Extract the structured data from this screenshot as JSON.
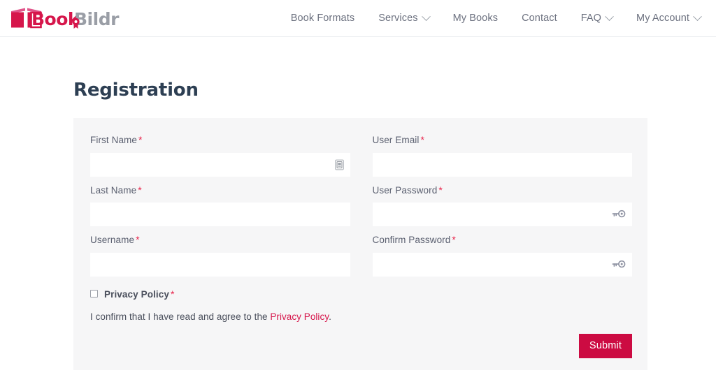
{
  "brand": {
    "name_part1": "Book",
    "name_part2": "Bildr",
    "color_primary": "#d6164b",
    "color_secondary": "#9a9ea6",
    "book_icon": "open-book-icon",
    "badge_icon": "ribbon-seal-icon"
  },
  "nav": {
    "items": [
      {
        "label": "Book Formats",
        "has_dropdown": false
      },
      {
        "label": "Services",
        "has_dropdown": true
      },
      {
        "label": "My Books",
        "has_dropdown": false
      },
      {
        "label": "Contact",
        "has_dropdown": false
      },
      {
        "label": "FAQ",
        "has_dropdown": true
      },
      {
        "label": "My Account",
        "has_dropdown": true
      }
    ]
  },
  "page": {
    "title": "Registration",
    "title_color": "#2d3f53"
  },
  "form": {
    "required_marker": "*",
    "fields_left": [
      {
        "label": "First Name",
        "required": true,
        "value": "",
        "placeholder": "",
        "type": "text",
        "icon": "autofill-icon",
        "name": "first-name"
      },
      {
        "label": "Last Name",
        "required": true,
        "value": "",
        "placeholder": "",
        "type": "text",
        "icon": "",
        "name": "last-name"
      },
      {
        "label": "Username",
        "required": true,
        "value": "",
        "placeholder": "",
        "type": "text",
        "icon": "",
        "name": "username"
      }
    ],
    "fields_right": [
      {
        "label": "User Email",
        "required": true,
        "value": "",
        "placeholder": "",
        "type": "text",
        "icon": "",
        "name": "user-email"
      },
      {
        "label": "User Password",
        "required": true,
        "value": "",
        "placeholder": "",
        "type": "password",
        "icon": "key-reveal-icon",
        "name": "user-password"
      },
      {
        "label": "Confirm Password",
        "required": true,
        "value": "",
        "placeholder": "",
        "type": "password",
        "icon": "key-reveal-icon",
        "name": "confirm-password"
      }
    ],
    "privacy": {
      "checkbox_label": "Privacy Policy",
      "required": true,
      "checked": false,
      "consent_prefix": "I confirm that I have read and agree to the ",
      "consent_link": "Privacy Policy",
      "consent_suffix": "."
    },
    "submit_label": "Submit",
    "submit_color": "#cc0b42"
  }
}
